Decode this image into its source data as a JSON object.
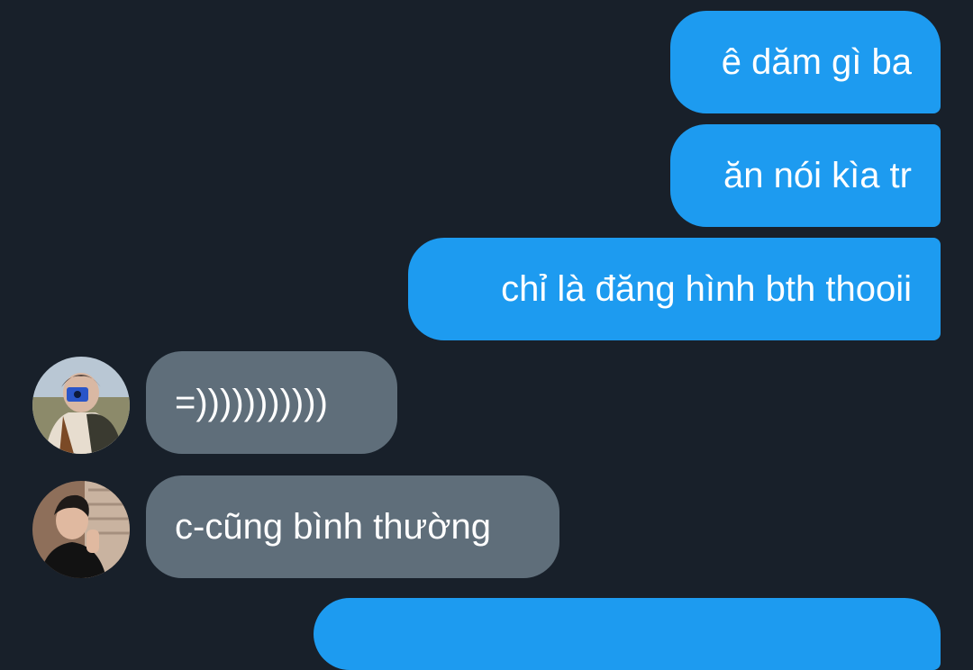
{
  "colors": {
    "background": "#18202a",
    "outgoing_bubble": "#1d9bf0",
    "incoming_bubble": "#5f6e7a",
    "text": "#ffffff"
  },
  "messages": [
    {
      "direction": "outgoing",
      "text": "ê dăm gì ba"
    },
    {
      "direction": "outgoing",
      "text": "ăn nói kìa tr"
    },
    {
      "direction": "outgoing",
      "text": "chỉ là đăng hình bth thooii"
    },
    {
      "direction": "incoming",
      "text": "=)))))))))))",
      "avatar": "user-avatar-camera-photo"
    },
    {
      "direction": "incoming",
      "text": "c-cũng bình thường",
      "avatar": "user-avatar-portrait-photo"
    },
    {
      "direction": "outgoing",
      "text": ""
    }
  ]
}
